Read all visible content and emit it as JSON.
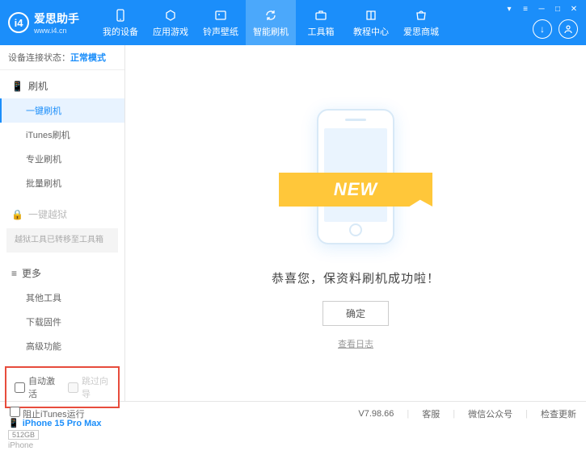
{
  "header": {
    "logo_title": "爱思助手",
    "logo_url": "www.i4.cn",
    "nav": [
      {
        "label": "我的设备"
      },
      {
        "label": "应用游戏"
      },
      {
        "label": "铃声壁纸"
      },
      {
        "label": "智能刷机"
      },
      {
        "label": "工具箱"
      },
      {
        "label": "教程中心"
      },
      {
        "label": "爱思商城"
      }
    ]
  },
  "sidebar": {
    "status_label": "设备连接状态：",
    "status_value": "正常模式",
    "section_flash": "刷机",
    "flash_items": [
      "一键刷机",
      "iTunes刷机",
      "专业刷机",
      "批量刷机"
    ],
    "section_jailbreak": "一键越狱",
    "jailbreak_note": "越狱工具已转移至工具箱",
    "section_more": "更多",
    "more_items": [
      "其他工具",
      "下载固件",
      "高级功能"
    ],
    "cb_auto_activate": "自动激活",
    "cb_skip_guide": "跳过向导",
    "device_name": "iPhone 15 Pro Max",
    "device_storage": "512GB",
    "device_type": "iPhone"
  },
  "main": {
    "ribbon": "NEW",
    "success": "恭喜您，保资料刷机成功啦！",
    "ok": "确定",
    "log": "查看日志"
  },
  "footer": {
    "block_itunes": "阻止iTunes运行",
    "version": "V7.98.66",
    "links": [
      "客服",
      "微信公众号",
      "检查更新"
    ]
  }
}
